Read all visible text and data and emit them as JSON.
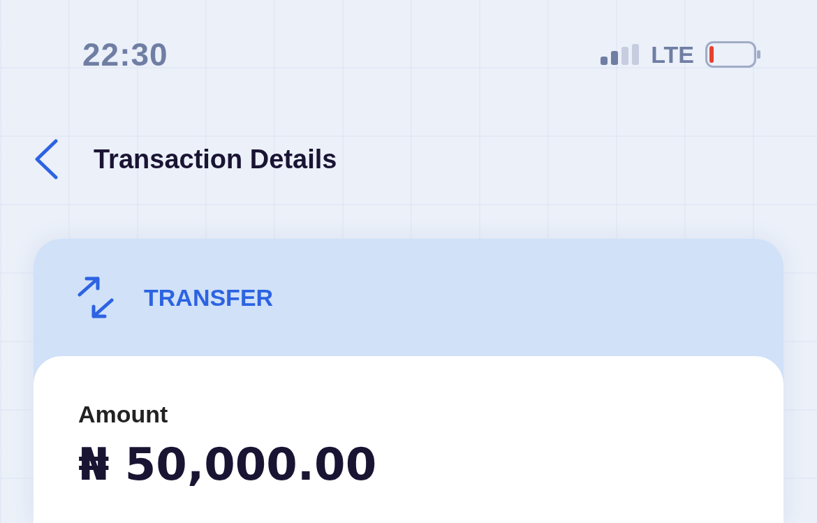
{
  "status_bar": {
    "time": "22:30",
    "network": "LTE"
  },
  "header": {
    "title": "Transaction Details"
  },
  "transaction": {
    "type": "TRANSFER",
    "amount_label": "Amount",
    "amount": "₦ 50,000.00"
  }
}
